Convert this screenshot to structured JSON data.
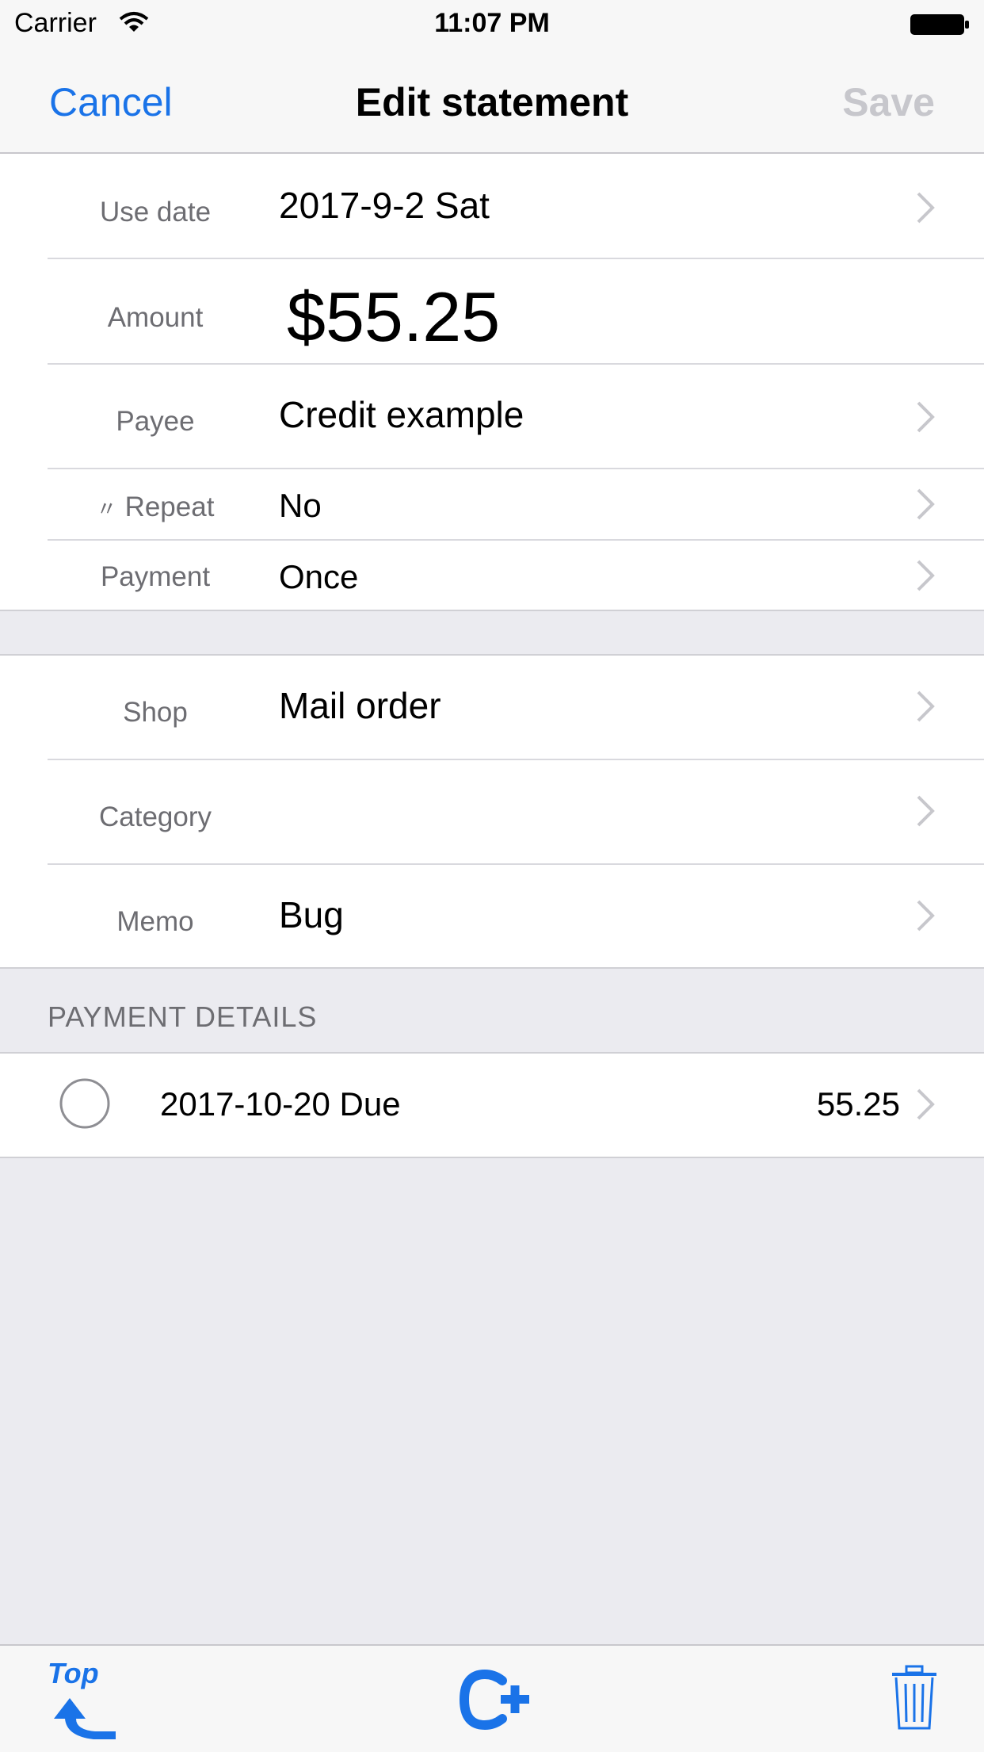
{
  "status_bar": {
    "carrier": "Carrier",
    "time": "11:07 PM"
  },
  "nav": {
    "cancel": "Cancel",
    "title": "Edit statement",
    "save": "Save"
  },
  "fields": {
    "use_date": {
      "label": "Use date",
      "value": "2017-9-2 Sat"
    },
    "amount": {
      "label": "Amount",
      "value": "$55.25"
    },
    "payee": {
      "label": "Payee",
      "value": "Credit example"
    },
    "repeat": {
      "label": "Repeat",
      "mark": "〃",
      "value": "No"
    },
    "payment": {
      "label": "Payment",
      "value": "Once"
    },
    "shop": {
      "label": "Shop",
      "value": "Mail order"
    },
    "category": {
      "label": "Category",
      "value": ""
    },
    "memo": {
      "label": "Memo",
      "value": "Bug"
    }
  },
  "payment_details": {
    "header": "PAYMENT DETAILS",
    "items": [
      {
        "date": "2017-10-20 Due",
        "amount": "55.25",
        "paid": false
      }
    ]
  },
  "toolbar": {
    "top_label": "Top",
    "add_icon": "add-copy-icon",
    "delete_icon": "trash-icon"
  },
  "colors": {
    "accent": "#1a73e8",
    "disabled": "#c7c7cc",
    "background": "#ebebf0"
  }
}
